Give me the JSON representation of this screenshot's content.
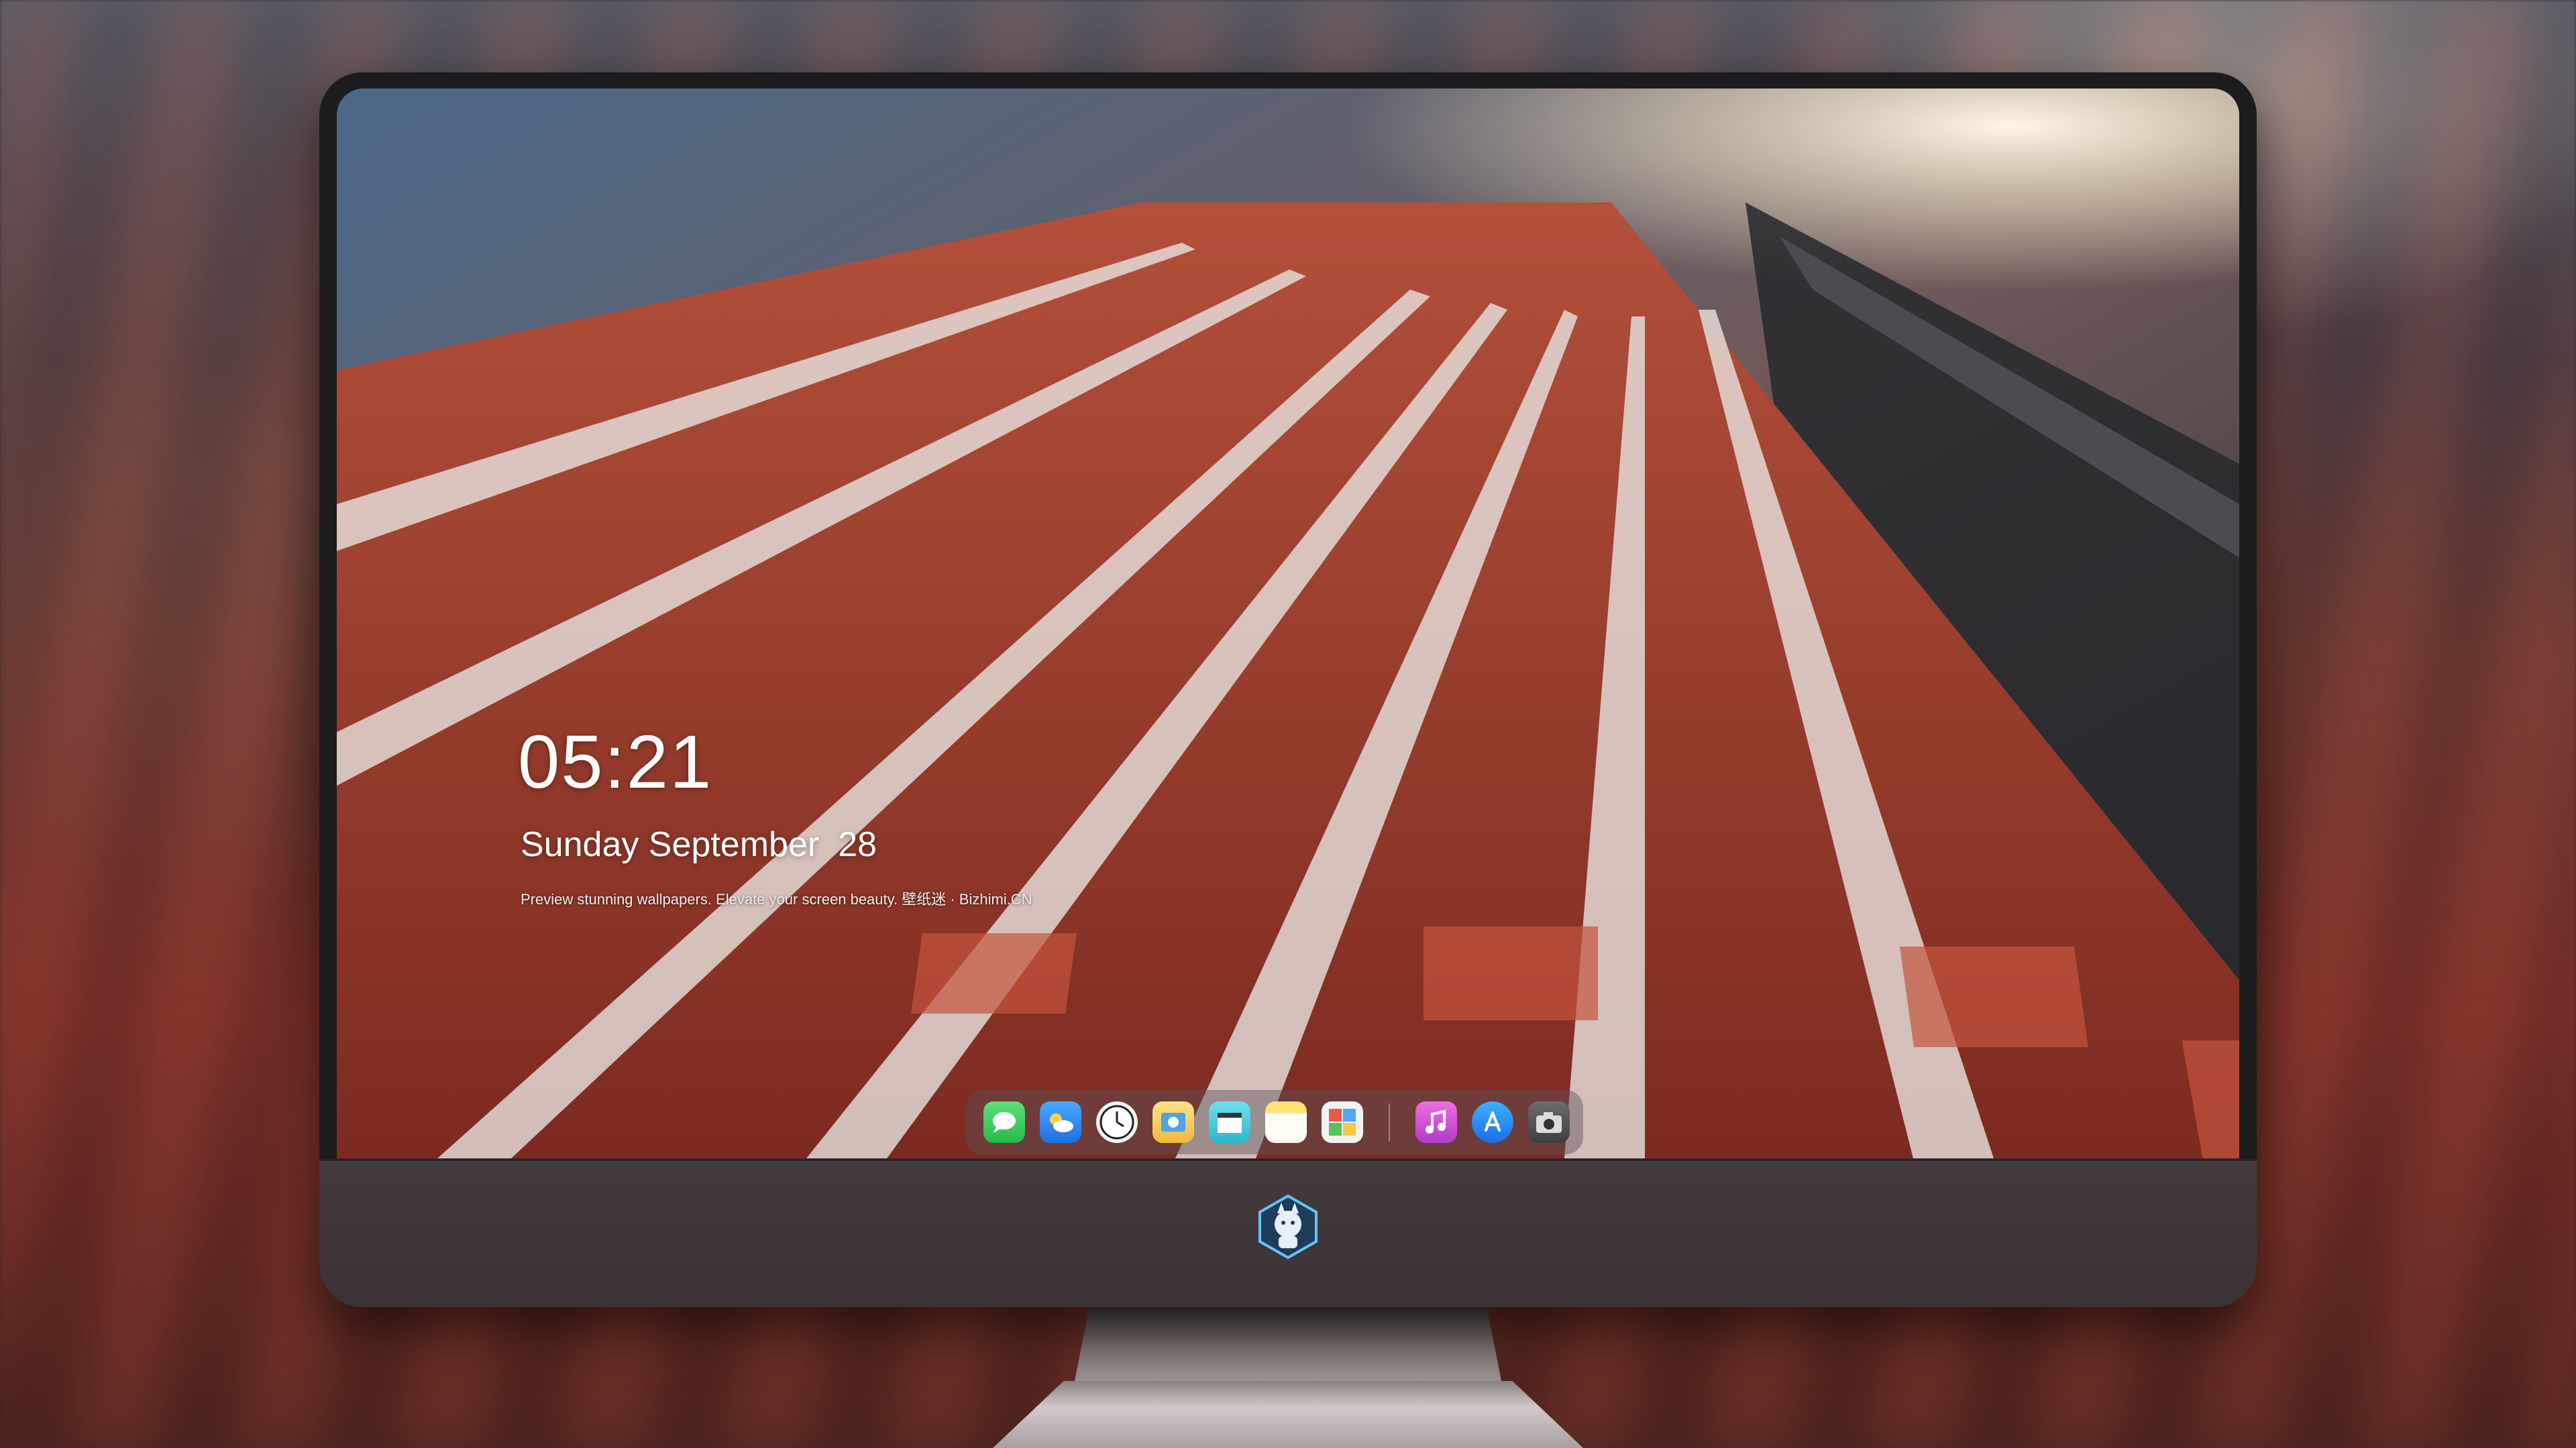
{
  "lockscreen": {
    "time": "05:21",
    "weekday_month": "Sunday September",
    "day": "28",
    "caption": "Preview stunning wallpapers. Elevate your screen beauty. 壁纸迷 · Bizhimi.CN"
  },
  "dock": {
    "apps": [
      {
        "icon": "messages-icon",
        "color": "#35c759"
      },
      {
        "icon": "weather-icon",
        "color": "#2b8cf0"
      },
      {
        "icon": "clock-icon",
        "color": "#f2f2f2"
      },
      {
        "icon": "preview-icon",
        "color": "#f5c84a"
      },
      {
        "icon": "claquette-video-icon",
        "color": "#3cc6d9"
      },
      {
        "icon": "notes-icon",
        "color": "#fbd54d"
      },
      {
        "icon": "photo-booth-icon",
        "color": "#e85d4a"
      },
      {
        "icon": "music-icon",
        "color": "#e04fd0"
      },
      {
        "icon": "app-store-icon",
        "color": "#1e90ff"
      },
      {
        "icon": "camera-icon",
        "color": "#555555"
      }
    ]
  },
  "monitor": {
    "logo_icon": "mascot-logo-icon"
  }
}
